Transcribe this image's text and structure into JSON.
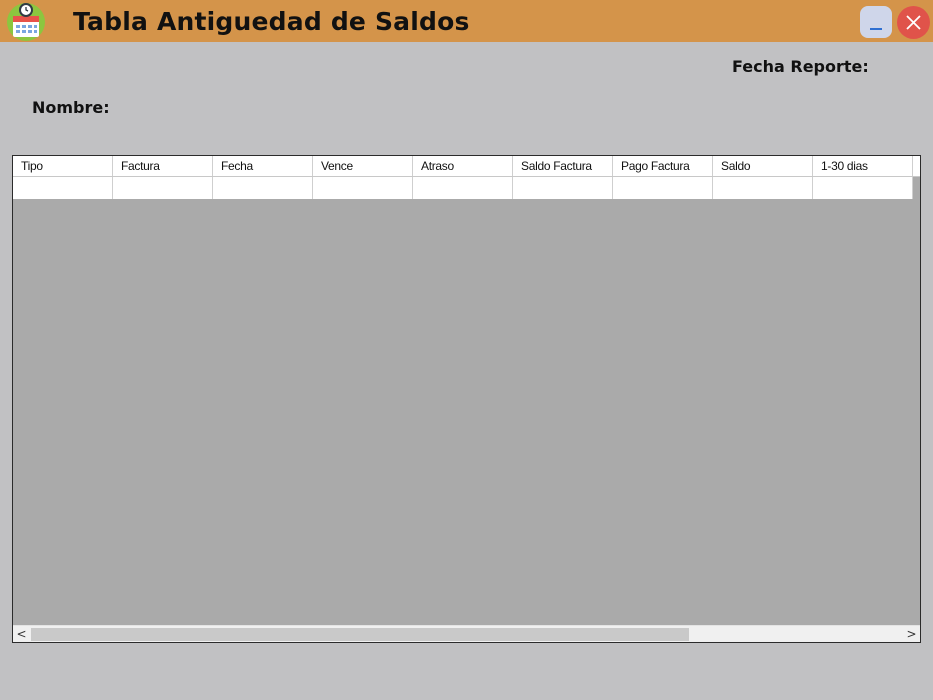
{
  "window": {
    "title": "Tabla Antiguedad de Saldos",
    "icon": "calendar-clock-icon",
    "minimize_label": "_",
    "close_icon": "close-icon"
  },
  "labels": {
    "fecha_reporte": "Fecha Reporte:",
    "nombre": "Nombre:"
  },
  "grid": {
    "columns": [
      "Tipo",
      "Factura",
      "Fecha",
      "Vence",
      "Atraso",
      "Saldo Factura",
      "Pago Factura",
      "Saldo",
      "1-30 dias"
    ],
    "rows": [
      [
        "",
        "",
        "",
        "",
        "",
        "",
        "",
        "",
        ""
      ]
    ]
  },
  "scrollbar": {
    "left_arrow": "<",
    "right_arrow": ">"
  },
  "colors": {
    "titlebar": "#d4944a",
    "background": "#c1c1c3",
    "grid_background": "#aaaaaa",
    "close_button": "#e0534a",
    "minimize_button": "#cfd6ea"
  }
}
